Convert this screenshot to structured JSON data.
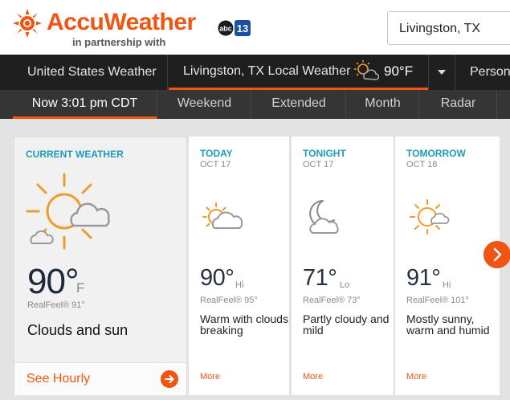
{
  "header": {
    "brand": "AccuWeather",
    "partner_text": "in partnership with",
    "partner_logo_text": "abc",
    "partner_logo_number": "13",
    "location": "Livingston, TX"
  },
  "nav": {
    "us_weather": "United States Weather",
    "local_weather": "Livingston, TX Local Weather",
    "local_temp": "90°F",
    "person": "Person"
  },
  "subnav": {
    "now": "Now 3:01 pm CDT",
    "weekend": "Weekend",
    "extended": "Extended",
    "month": "Month",
    "radar": "Radar"
  },
  "current": {
    "title": "CURRENT WEATHER",
    "temp": "90°",
    "unit": "F",
    "realfeel": "RealFeel® 91°",
    "phrase": "Clouds and sun",
    "see_hourly": "See Hourly",
    "icon": "partly-sunny-icon"
  },
  "forecast": [
    {
      "title": "TODAY",
      "date": "OCT 17",
      "temp": "90°",
      "suffix": "Hi",
      "realfeel": "RealFeel® 95°",
      "phrase": "Warm with clouds breaking",
      "more": "More",
      "icon": "partly-sunny-icon"
    },
    {
      "title": "TONIGHT",
      "date": "OCT 17",
      "temp": "71°",
      "suffix": "Lo",
      "realfeel": "RealFeel® 73°",
      "phrase": "Partly cloudy and mild",
      "more": "More",
      "icon": "partly-cloudy-night-icon"
    },
    {
      "title": "TOMORROW",
      "date": "OCT 18",
      "temp": "91°",
      "suffix": "Hi",
      "realfeel": "RealFeel® 101°",
      "phrase": "Mostly sunny, warm and humid",
      "more": "More",
      "icon": "mostly-sunny-icon"
    }
  ],
  "colors": {
    "brand_orange": "#f05514",
    "accent_teal": "#1e9bba",
    "nav_dark": "#1f1f1f"
  }
}
